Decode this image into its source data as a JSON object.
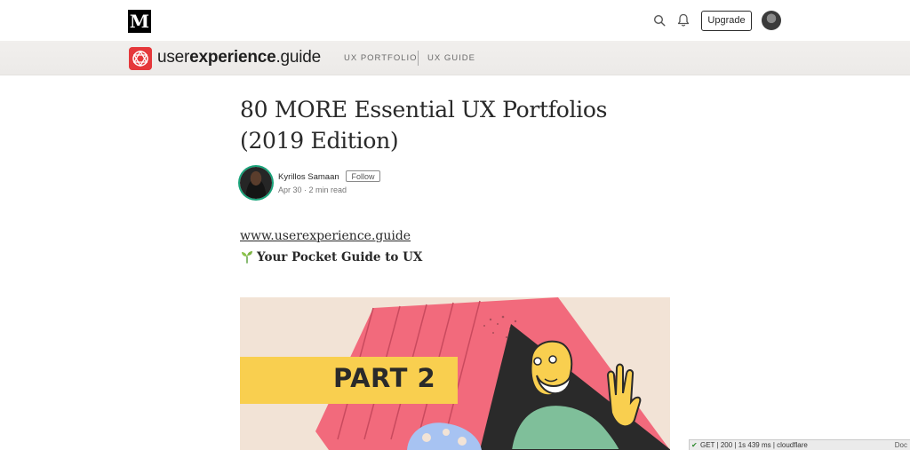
{
  "topbar": {
    "logo_letter": "M",
    "upgrade_label": "Upgrade"
  },
  "publication": {
    "name_light": "user",
    "name_bold": "experience",
    "name_suffix": ".guide",
    "nav": [
      {
        "label": "UX PORTFOLIO"
      },
      {
        "label": "UX GUIDE"
      }
    ]
  },
  "article": {
    "title": "80 MORE Essential UX Portfolios (2019 Edition)",
    "author": "Kyrillos Samaan",
    "follow_label": "Follow",
    "meta": "Apr 30 · 2 min read",
    "link_text": "www.userexperience.guide",
    "tagline": "Your Pocket Guide to UX",
    "hero_text": "PART 2"
  },
  "status_bar": {
    "text": "GET | 200 | 1s 439 ms | cloudflare",
    "right_label": "Doc"
  },
  "colors": {
    "pub_accent": "#e5383b",
    "author_ring": "#1aa37a",
    "hero_background": "#f2e3d6",
    "hero_pink": "#f26a7c",
    "hero_yellow": "#f9cf4f"
  }
}
